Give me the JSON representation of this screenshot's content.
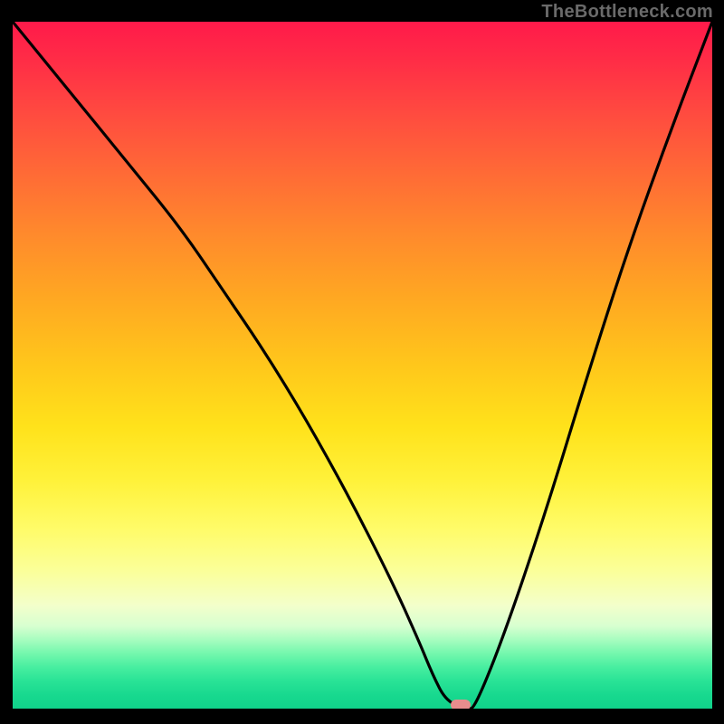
{
  "watermark": "TheBottleneck.com",
  "colors": {
    "frame": "#000000",
    "curve": "#000000",
    "marker": "#e98d8d",
    "gradient_top": "#ff1a4a",
    "gradient_bottom": "#10d28a"
  },
  "chart_data": {
    "type": "line",
    "title": "",
    "xlabel": "",
    "ylabel": "",
    "xlim": [
      0,
      100
    ],
    "ylim": [
      0,
      100
    ],
    "gradient_stops": [
      {
        "pos": 0,
        "color": "#ff1a4a"
      },
      {
        "pos": 50,
        "color": "#ffc71b"
      },
      {
        "pos": 80,
        "color": "#fdffa8"
      },
      {
        "pos": 100,
        "color": "#10d28a"
      }
    ],
    "series": [
      {
        "name": "bottleneck-curve",
        "x": [
          0,
          8,
          16,
          24,
          30,
          36,
          42,
          48,
          54,
          58,
          60,
          62,
          65,
          66,
          70,
          76,
          82,
          88,
          94,
          100
        ],
        "values": [
          100,
          90,
          80,
          70,
          61,
          52,
          42,
          31,
          19,
          10,
          5,
          1,
          0,
          0,
          10,
          28,
          48,
          67,
          84,
          100
        ]
      }
    ],
    "marker": {
      "x": 64,
      "y": 0,
      "label": "optimal-point"
    },
    "annotations": []
  }
}
